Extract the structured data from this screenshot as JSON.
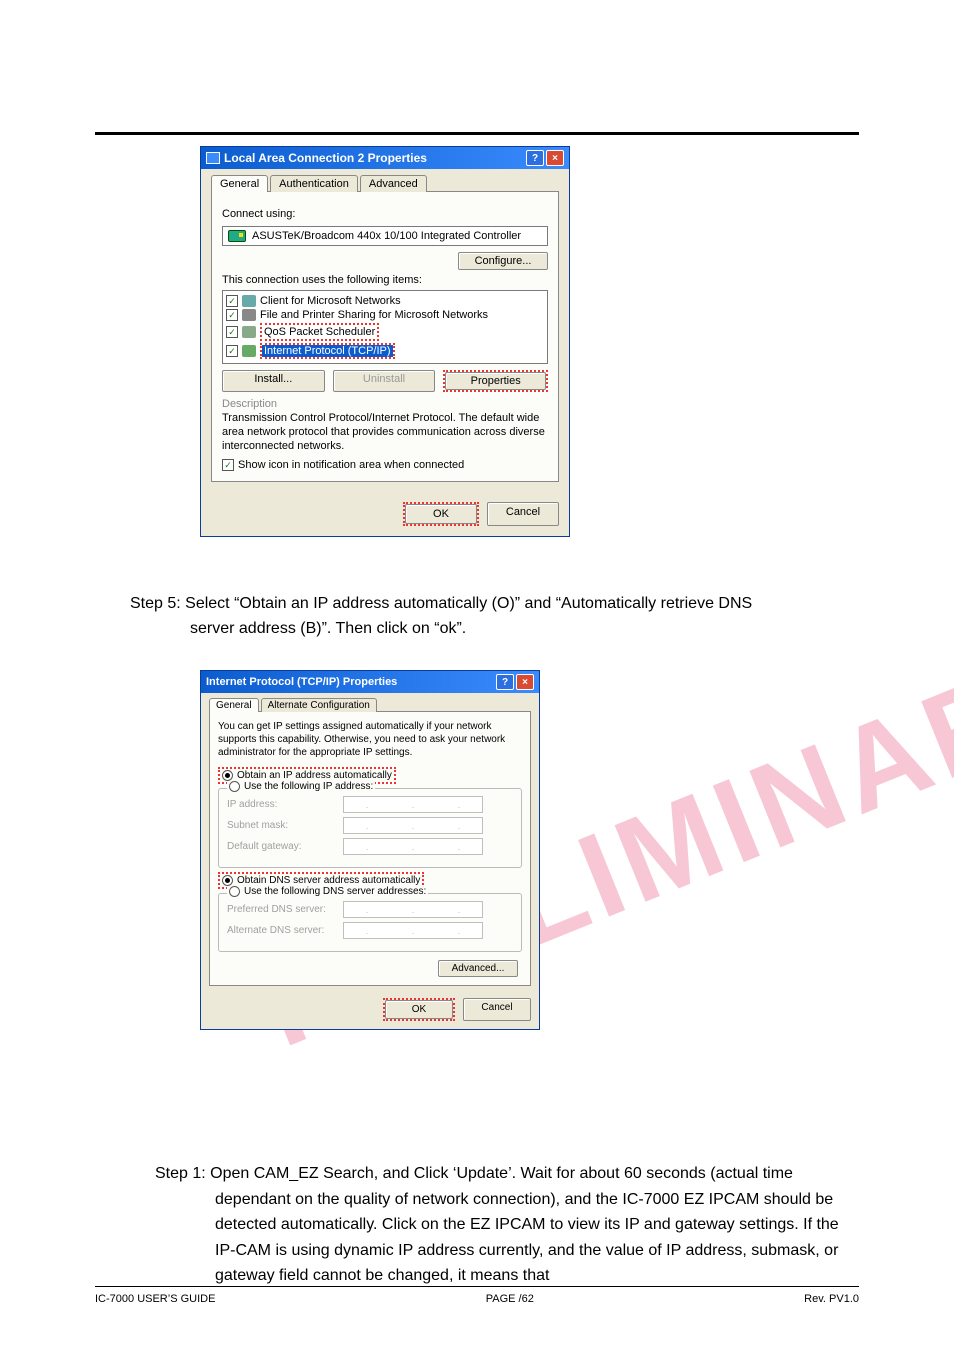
{
  "dlg1": {
    "title": "Local Area Connection 2 Properties",
    "tabs": [
      "General",
      "Authentication",
      "Advanced"
    ],
    "connect_using_label": "Connect using:",
    "adapter": "ASUSTeK/Broadcom 440x 10/100 Integrated Controller",
    "configure_btn": "Configure...",
    "items_label": "This connection uses the following items:",
    "items": [
      "Client for Microsoft Networks",
      "File and Printer Sharing for Microsoft Networks",
      "QoS Packet Scheduler",
      "Internet Protocol (TCP/IP)"
    ],
    "install_btn": "Install...",
    "uninstall_btn": "Uninstall",
    "properties_btn": "Properties",
    "desc_title": "Description",
    "desc_text": "Transmission Control Protocol/Internet Protocol. The default wide area network protocol that provides communication across diverse interconnected networks.",
    "show_icon": "Show icon in notification area when connected",
    "ok": "OK",
    "cancel": "Cancel"
  },
  "step5": {
    "line1": "Step 5: Select “Obtain an IP address automatically (O)” and “Automatically retrieve DNS",
    "line2": "server address (B)”. Then click on “ok”."
  },
  "dlg2": {
    "title": "Internet Protocol (TCP/IP) Properties",
    "tabs": [
      "General",
      "Alternate Configuration"
    ],
    "info": "You can get IP settings assigned automatically if your network supports this capability. Otherwise, you need to ask your network administrator for the appropriate IP settings.",
    "obtain_ip": "Obtain an IP address automatically",
    "use_ip": "Use the following IP address:",
    "ip_addr": "IP address:",
    "subnet": "Subnet mask:",
    "gateway": "Default gateway:",
    "obtain_dns": "Obtain DNS server address automatically",
    "use_dns": "Use the following DNS server addresses:",
    "pref_dns": "Preferred DNS server:",
    "alt_dns": "Alternate DNS server:",
    "advanced": "Advanced...",
    "ok": "OK",
    "cancel": "Cancel"
  },
  "watermark": "PRELIMINARY",
  "step1": {
    "text": "Step 1: Open CAM_EZ Search, and Click ‘Update’. Wait for about 60 seconds (actual time dependant on the quality of network connection), and the IC-7000 EZ IPCAM should be detected automatically. Click on the EZ IPCAM to view its IP and gateway settings. If the IP-CAM is using dynamic IP address currently, and the value of IP address, submask, or gateway field cannot be changed, it means that"
  },
  "footer": {
    "left": "IC-7000 USER’S GUIDE",
    "center": "PAGE   /62",
    "right": "Rev. PV1.0"
  }
}
